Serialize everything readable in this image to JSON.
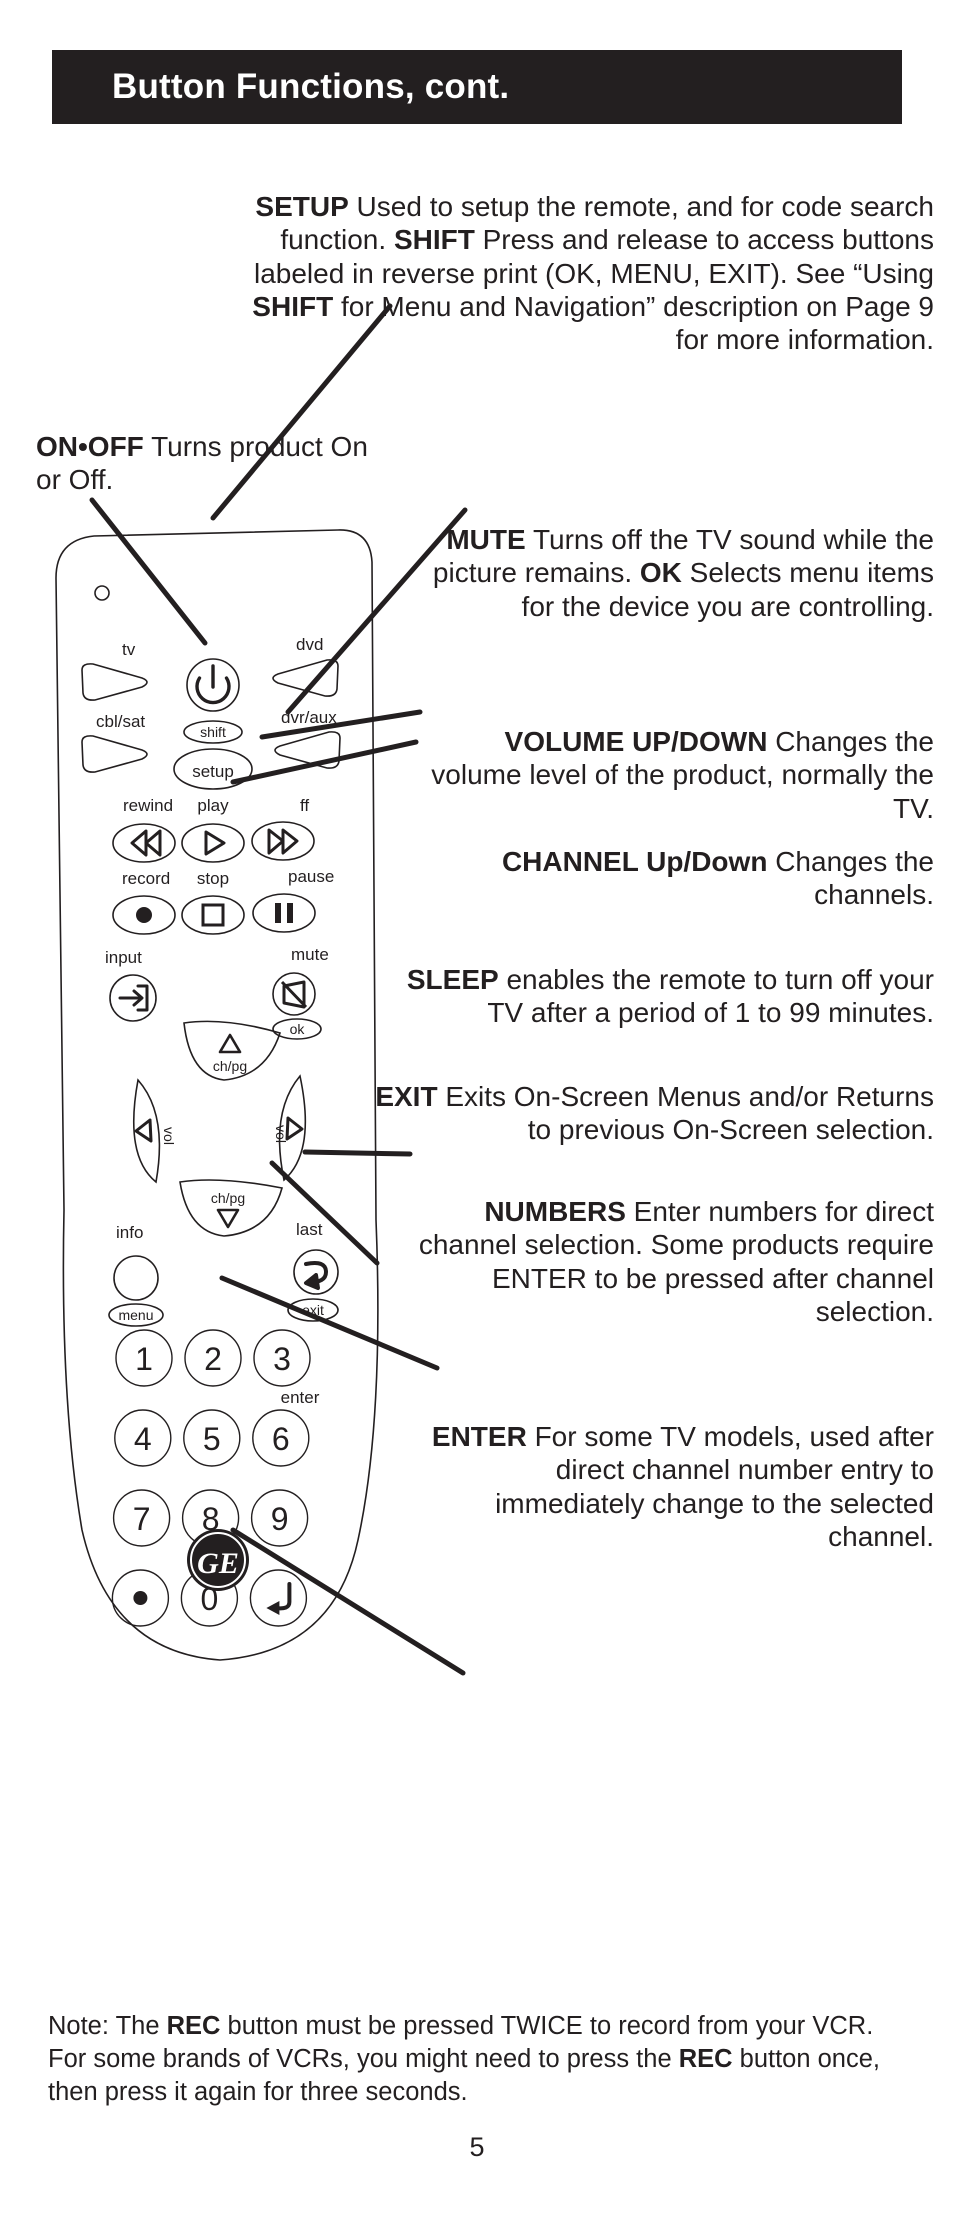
{
  "header": {
    "title": "Button Functions, cont."
  },
  "page": {
    "number": "5"
  },
  "callouts": {
    "setup_shift": {
      "name": "setup-shift-callout",
      "segments": [
        {
          "text": "SETUP",
          "bold": true
        },
        {
          "text": " Used to setup the remote, and for code search function. ",
          "bold": false
        },
        {
          "text": "SHIFT",
          "bold": true
        },
        {
          "text": " Press and release to access buttons labeled in reverse print (OK, MENU, EXIT). See “Using ",
          "bold": false
        },
        {
          "text": "SHIFT",
          "bold": true
        },
        {
          "text": " for Menu and Navigation” description on Page 9 for more information.",
          "bold": false
        }
      ]
    },
    "onoff": {
      "name": "on-off-callout",
      "segments": [
        {
          "text": "ON•OFF",
          "bold": true
        },
        {
          "text": " Turns product On or Off.",
          "bold": false
        }
      ]
    },
    "mute_ok": {
      "name": "mute-ok-callout",
      "segments": [
        {
          "text": "MUTE",
          "bold": true
        },
        {
          "text": " Turns off the TV sound while the picture remains. ",
          "bold": false
        },
        {
          "text": "OK",
          "bold": true
        },
        {
          "text": " Selects menu items for the device you are controlling.",
          "bold": false
        }
      ]
    },
    "volume": {
      "name": "volume-callout",
      "segments": [
        {
          "text": "VOLUME UP/DOWN",
          "bold": true
        },
        {
          "text": " Changes the volume level of the product, normally the TV.",
          "bold": false
        }
      ]
    },
    "channel": {
      "name": "channel-callout",
      "segments": [
        {
          "text": "CHANNEL Up/Down",
          "bold": true
        },
        {
          "text": " Changes the channels.",
          "bold": false
        }
      ]
    },
    "sleep": {
      "name": "sleep-callout",
      "segments": [
        {
          "text": "SLEEP",
          "bold": true
        },
        {
          "text": " enables the remote to turn off your TV after a period of 1 to 99 minutes.",
          "bold": false
        }
      ]
    },
    "exit": {
      "name": "exit-callout",
      "segments": [
        {
          "text": "EXIT",
          "bold": true
        },
        {
          "text": " Exits On-Screen Menus and/or Returns to previous On-Screen selection.",
          "bold": false
        }
      ]
    },
    "numbers": {
      "name": "numbers-callout",
      "segments": [
        {
          "text": "NUMBERS",
          "bold": true
        },
        {
          "text": " Enter numbers for direct channel selection. Some products require ENTER to be pressed after channel selection.",
          "bold": false
        }
      ]
    },
    "enter": {
      "name": "enter-callout",
      "segments": [
        {
          "text": "ENTER",
          "bold": true
        },
        {
          "text": " For some TV models, used after direct channel number entry to immediately change to the selected channel.",
          "bold": false
        }
      ]
    }
  },
  "note": {
    "segments": [
      {
        "text": "Note: The ",
        "bold": false
      },
      {
        "text": "REC",
        "bold": true
      },
      {
        "text": " button must be pressed TWICE to record from your VCR. For some brands of VCRs, you might need to press the ",
        "bold": false
      },
      {
        "text": "REC",
        "bold": true
      },
      {
        "text": " button once, then press it again for three seconds.",
        "bold": false
      }
    ]
  },
  "remote": {
    "labels": {
      "tv": "tv",
      "dvd": "dvd",
      "cbl_sat": "cbl/sat",
      "dvr_aux": "dvr/aux",
      "shift": "shift",
      "setup": "setup",
      "rewind": "rewind",
      "play": "play",
      "ff": "ff",
      "record": "record",
      "stop": "stop",
      "pause": "pause",
      "input": "input",
      "mute": "mute",
      "ok": "ok",
      "ch_pg_up": "ch/pg",
      "ch_pg_down": "ch/pg",
      "vol_left": "vol",
      "vol_right": "vol",
      "info": "info",
      "last": "last",
      "menu": "menu",
      "exit": "exit",
      "enter": "enter",
      "brand": "GE"
    },
    "keypad": [
      [
        "1",
        "2",
        "3"
      ],
      [
        "4",
        "5",
        "6"
      ],
      [
        "7",
        "8",
        "9"
      ],
      [
        "•",
        "0",
        "↵"
      ]
    ]
  },
  "colors": {
    "header_bg": "#231f20",
    "header_text": "#ffffff",
    "body_text": "#231f20",
    "page_bg": "#ffffff",
    "line": "#231f20"
  }
}
